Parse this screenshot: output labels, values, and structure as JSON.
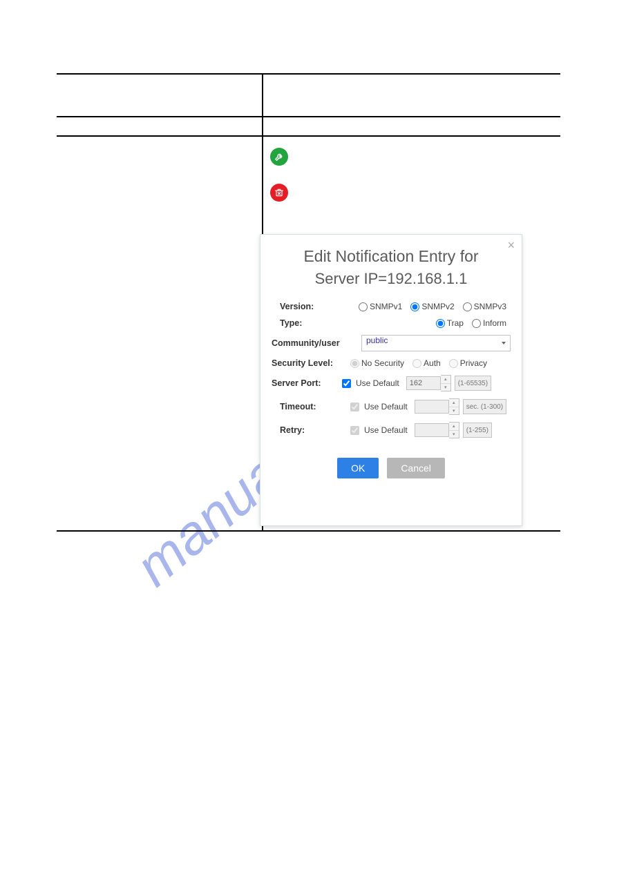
{
  "watermark": "manualshive.com",
  "table": {
    "rows": [
      {
        "c1": "",
        "c2": ""
      },
      {
        "c1": "",
        "c2": ""
      }
    ],
    "actions": {
      "edit_icon": "wrench-icon",
      "delete_icon": "trash-icon"
    }
  },
  "dialog": {
    "close": "×",
    "title_line1": "Edit Notification Entry for",
    "title_line2": "Server IP=192.168.1.1",
    "version": {
      "label": "Version:",
      "options": [
        "SNMPv1",
        "SNMPv2",
        "SNMPv3"
      ],
      "selected": "SNMPv2"
    },
    "type": {
      "label": "Type:",
      "options": [
        "Trap",
        "Inform"
      ],
      "selected": "Trap"
    },
    "community": {
      "label": "Community/user",
      "value": "public"
    },
    "security": {
      "label": "Security Level:",
      "options": [
        "No Security",
        "Auth",
        "Privacy"
      ],
      "selected": "No Security"
    },
    "server_port": {
      "label": "Server Port:",
      "use_default_label": "Use Default",
      "use_default": true,
      "value": "162",
      "hint": "(1-65535)"
    },
    "timeout": {
      "label": "Timeout:",
      "use_default_label": "Use Default",
      "use_default": true,
      "value": "",
      "hint": "sec. (1-300)"
    },
    "retry": {
      "label": "Retry:",
      "use_default_label": "Use Default",
      "use_default": true,
      "value": "",
      "hint": "(1-255)"
    },
    "buttons": {
      "ok": "OK",
      "cancel": "Cancel"
    }
  }
}
